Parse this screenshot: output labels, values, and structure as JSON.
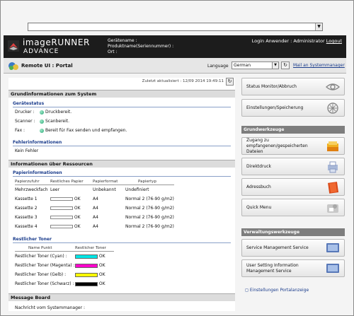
{
  "header": {
    "brand_line1": "imageRUNNER",
    "brand_line2": "ADVANCE",
    "device_name_label": "Gerätename :",
    "product_name_label": "Produktname(Seriennummer) :",
    "location_label": "Ort :",
    "login_text": "Login Anwender : Administrator",
    "logout_label": "Logout"
  },
  "subheader": {
    "title": "Remote UI : Portal",
    "language_label": "Language",
    "language_value": "German",
    "mail_link": "Mail an Systemmanager"
  },
  "main": {
    "last_updated": "Zuletzt aktualisiert : 12/09 2014 19:49:11",
    "section_basic": "Grundinformationen zum System",
    "device_status_title": "Gerätestatus",
    "status_rows": [
      {
        "label": "Drucker :",
        "value": "Druckbereit."
      },
      {
        "label": "Scanner :",
        "value": "Scanbereit."
      },
      {
        "label": "Fax :",
        "value": "Bereit für Fax senden und empfangen."
      }
    ],
    "error_title": "Fehlerinformationen",
    "error_value": "Kein Fehler",
    "section_resources": "Informationen über Ressourcen",
    "paper_title": "Papierinformationen",
    "paper_headers": [
      "Papierzufuhr",
      "Restliches Papier",
      "Papierformat",
      "Papiertyp"
    ],
    "paper_rows": [
      {
        "source": "Mehrzweckfach",
        "remaining": "Leer",
        "format": "Unbekannt",
        "type": "Undefiniert",
        "bar": false
      },
      {
        "source": "Kassette 1",
        "remaining": "OK",
        "format": "A4",
        "type": "Normal 2 (76-90 g/m2)",
        "bar": true
      },
      {
        "source": "Kassette 2",
        "remaining": "OK",
        "format": "A4",
        "type": "Normal 2 (76-90 g/m2)",
        "bar": true
      },
      {
        "source": "Kassette 3",
        "remaining": "OK",
        "format": "A4",
        "type": "Normal 2 (76-90 g/m2)",
        "bar": true
      },
      {
        "source": "Kassette 4",
        "remaining": "OK",
        "format": "A4",
        "type": "Normal 2 (76-90 g/m2)",
        "bar": true
      }
    ],
    "toner_title": "Restlicher Toner",
    "toner_headers": [
      "Name Punkt",
      "Restlicher Toner"
    ],
    "toner_rows": [
      {
        "name": "Restlicher Toner (Cyan) :",
        "value": "OK",
        "color": "#00e5e5"
      },
      {
        "name": "Restlicher Toner (Magenta) :",
        "value": "OK",
        "color": "#ff00cc"
      },
      {
        "name": "Restlicher Toner (Gelb) :",
        "value": "OK",
        "color": "#ffff00"
      },
      {
        "name": "Restlicher Toner (Schwarz) :",
        "value": "OK",
        "color": "#000000"
      }
    ],
    "message_board_title": "Message Board",
    "message_label": "Nachricht vom Systemmanager :"
  },
  "sidebar": {
    "status_monitor": "Status Monitor/Abbruch",
    "settings": "Einstellungen/Speicherung",
    "basic_tools_title": "Grundwerkzeuge",
    "access_files": "Zugang zu empfangenen/gespeicherten Dateien",
    "direct_print": "Direktdruck",
    "address_book": "Adressbuch",
    "quick_menu": "Quick Menu",
    "admin_tools_title": "Verwaltungswerkzeuge",
    "service_mgmt": "Service Management Service",
    "user_setting": "User Setting Information Management Service",
    "portal_settings": "Einstellungen Portalanzeige"
  }
}
